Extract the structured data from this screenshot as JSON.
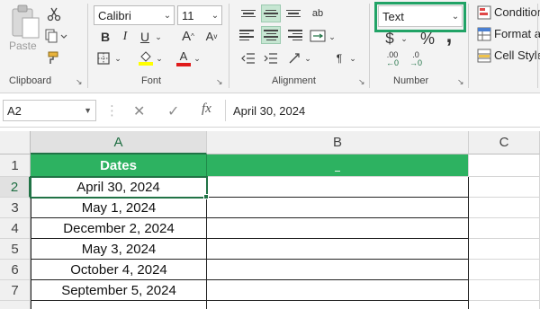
{
  "ribbon": {
    "clipboard": {
      "paste_label": "Paste",
      "group_label": "Clipboard"
    },
    "font": {
      "font_name": "Calibri",
      "font_size": "11",
      "bold": "B",
      "italic": "I",
      "underline": "U",
      "grow": "A",
      "shrink": "A",
      "font_color": "A",
      "group_label": "Font"
    },
    "alignment": {
      "wrap_glyph": "ab",
      "group_label": "Alignment",
      "indent_glyph": "¶"
    },
    "number": {
      "format": "Text",
      "currency": "$",
      "percent": "%",
      "comma": ",",
      "dec_inc": ".00",
      "dec_dec": ".0",
      "group_label": "Number"
    },
    "styles": {
      "conditional": "Conditional Formatting",
      "format_as": "Format as Table",
      "cell_styles": "Cell Styles"
    }
  },
  "formula_bar": {
    "name_box": "A2",
    "fx": "fx",
    "value": "April 30, 2024"
  },
  "columns": [
    "A",
    "B",
    "C"
  ],
  "rows": [
    "1",
    "2",
    "3",
    "4",
    "5",
    "6",
    "7"
  ],
  "sheet": {
    "header": "Dates",
    "dates": [
      "April 30, 2024",
      "May 1, 2024",
      "December 2, 2024",
      "May 3, 2024",
      "October 4, 2024",
      "September 5, 2024"
    ]
  },
  "colors": {
    "accent": "#217346",
    "header_fill": "#2db261",
    "highlight": "#21a366"
  }
}
